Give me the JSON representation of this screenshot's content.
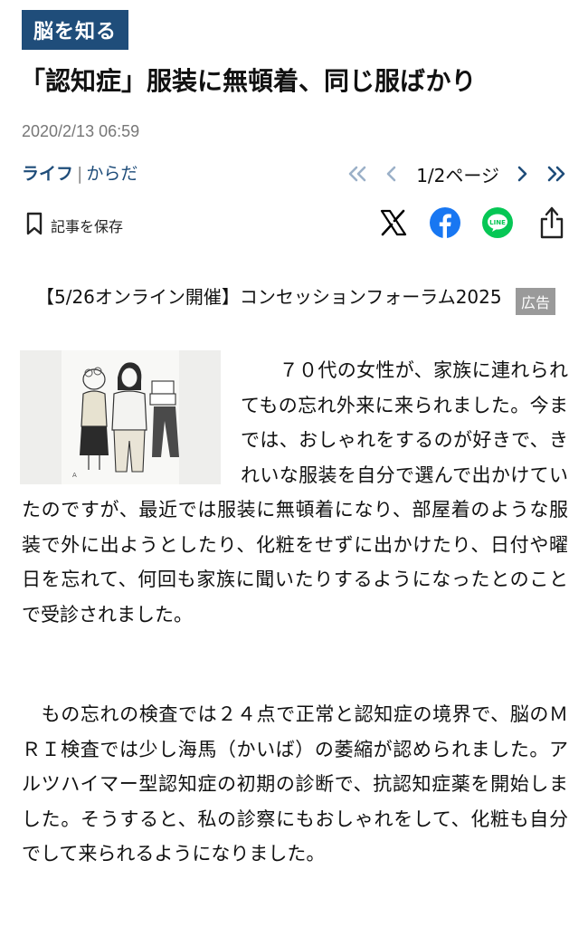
{
  "tag": "脳を知る",
  "title": "「認知症」服装に無頓着、同じ服ばかり",
  "date": "2020/2/13 06:59",
  "category": {
    "main": "ライフ",
    "separator": "|",
    "sub": "からだ"
  },
  "pager": {
    "label": "1/2ページ",
    "icons": [
      "double-chevron-left-icon",
      "chevron-left-icon",
      "chevron-right-icon",
      "double-chevron-right-icon"
    ],
    "disabled_color": "#9bb0c8",
    "active_color": "#1f4d7a"
  },
  "save": {
    "label": "記事を保存",
    "icon": "bookmark-icon"
  },
  "share": [
    {
      "name": "x-share",
      "icon": "x-logo-icon",
      "color": "#000000"
    },
    {
      "name": "facebook-share",
      "icon": "facebook-icon",
      "color": "#1877f2"
    },
    {
      "name": "line-share",
      "icon": "line-icon",
      "color": "#06c755"
    },
    {
      "name": "system-share",
      "icon": "share-icon",
      "color": "#222222"
    }
  ],
  "promo": {
    "text": "【5/26オンライン開催】コンセッションフォーラム2025",
    "badge": "広告"
  },
  "article": {
    "paragraphs": [
      "　　７０代の女性が、家族に連れられてもの忘れ外来に来られました。今までは、おしゃれをするのが好きで、きれいな服装を自分で選んで出かけていたのですが、最近では服装に無頓着になり、部屋着のような服装で外に出ようとしたり、化粧をせずに出かけたり、日付や曜日を忘れて、何回も家族に聞いたりするようになったとのことで受診されました。",
      "　もの忘れの検査では２４点で正常と認知症の境界で、脳のＭＲＩ検査では少し海馬（かいば）の萎縮が認められました。アルツハイマー型認知症の初期の診断で、抗認知症薬を開始しました。そうすると、私の診察にもおしゃれをして、化粧も自分でして来られるようになりました。"
    ]
  },
  "colors": {
    "brand": "#1f4d7a",
    "date": "#777777",
    "ad_badge": "#9a9a9a"
  }
}
